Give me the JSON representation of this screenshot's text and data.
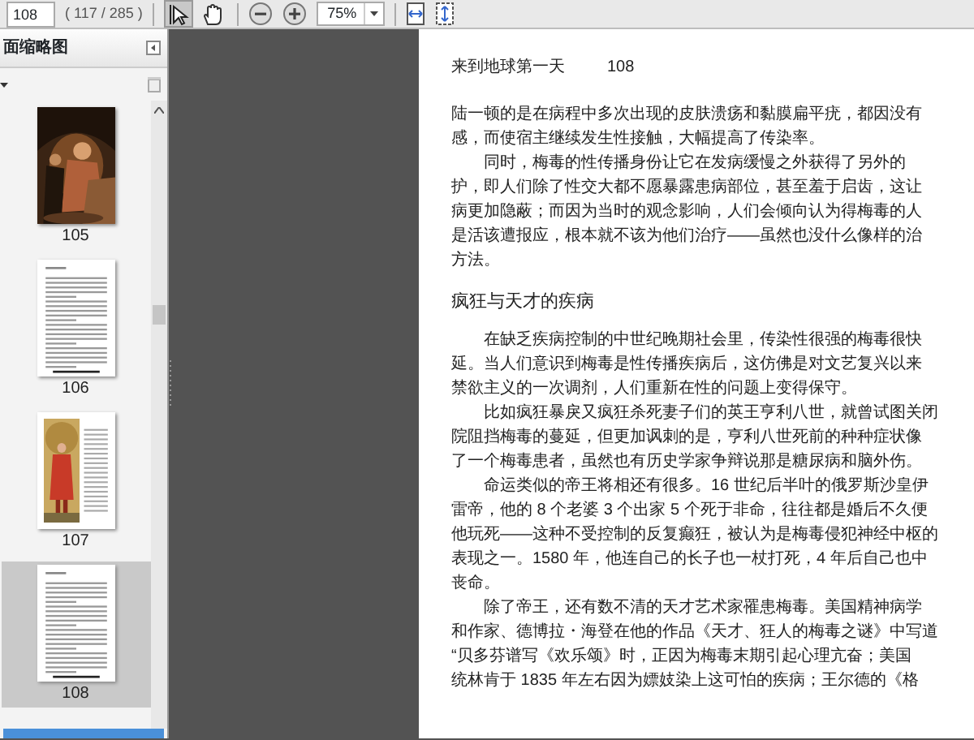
{
  "toolbar": {
    "page_field": "108",
    "page_count": "( 117 / 285 )",
    "tools": [
      {
        "kind": "select",
        "selected": true
      },
      {
        "kind": "hand",
        "selected": false
      }
    ],
    "zoom": "75%"
  },
  "sidebar": {
    "title": "面缩略图",
    "thumbnails": [
      {
        "label": "105",
        "kind": "picture",
        "selected": false
      },
      {
        "label": "106",
        "kind": "text",
        "selected": false
      },
      {
        "label": "107",
        "kind": "illustrated",
        "selected": false
      },
      {
        "label": "108",
        "kind": "text",
        "selected": true
      }
    ]
  },
  "document": {
    "running_title": "来到地球第一天",
    "page_number": "108",
    "blocks": [
      {
        "kind": "paragraph",
        "indent": false,
        "lines": [
          "陆一顿的是在病程中多次出现的皮肤溃疡和黏膜扁平疣，都因没有",
          "感，而使宿主继续发生性接触，大幅提高了传染率。"
        ]
      },
      {
        "kind": "paragraph",
        "indent": true,
        "lines": [
          "同时，梅毒的性传播身份让它在发病缓慢之外获得了另外的",
          "护，即人们除了性交大都不愿暴露患病部位，甚至羞于启齿，这让",
          "病更加隐蔽；而因为当时的观念影响，人们会倾向认为得梅毒的人",
          "是活该遭报应，根本就不该为他们治疗——虽然也没什么像样的治",
          "方法。"
        ]
      },
      {
        "kind": "heading",
        "lines": [
          "疯狂与天才的疾病"
        ]
      },
      {
        "kind": "paragraph",
        "indent": true,
        "lines": [
          "在缺乏疾病控制的中世纪晚期社会里，传染性很强的梅毒很快",
          "延。当人们意识到梅毒是性传播疾病后，这仿佛是对文艺复兴以来",
          "禁欲主义的一次调剂，人们重新在性的问题上变得保守。"
        ]
      },
      {
        "kind": "paragraph",
        "indent": true,
        "lines": [
          "比如疯狂暴戾又疯狂杀死妻子们的英王亨利八世，就曾试图关闭",
          "院阻挡梅毒的蔓延，但更加讽刺的是，亨利八世死前的种种症状像",
          "了一个梅毒患者，虽然也有历史学家争辩说那是糖尿病和脑外伤。"
        ]
      },
      {
        "kind": "paragraph",
        "indent": true,
        "lines": [
          "命运类似的帝王将相还有很多。16 世纪后半叶的俄罗斯沙皇伊",
          "雷帝，他的 8 个老婆 3 个出家 5 个死于非命，往往都是婚后不久便",
          "他玩死——这种不受控制的反复癫狂，被认为是梅毒侵犯神经中枢的",
          "表现之一。1580 年，他连自己的长子也一杖打死，4 年后自己也中",
          "丧命。"
        ]
      },
      {
        "kind": "paragraph",
        "indent": true,
        "lines": [
          "除了帝王，还有数不清的天才艺术家罹患梅毒。美国精神病学",
          "和作家、德博拉・海登在他的作品《天才、狂人的梅毒之谜》中写道",
          "“贝多芬谱写《欢乐颂》时，正因为梅毒末期引起心理亢奋；美国",
          "统林肯于 1835 年左右因为嫖妓染上这可怕的疾病；王尔德的《格"
        ]
      }
    ]
  }
}
